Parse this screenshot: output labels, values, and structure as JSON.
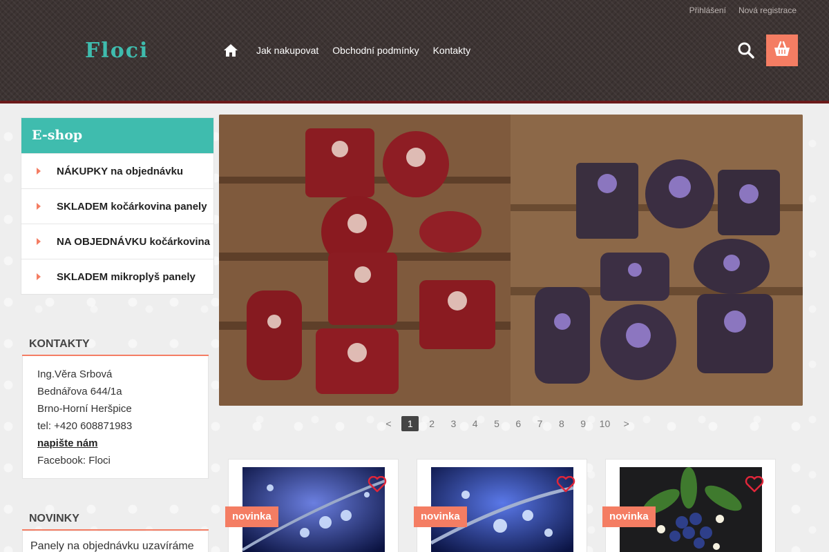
{
  "top_links": [
    "Přihlášení",
    "Nová registrace"
  ],
  "logo": "Floci",
  "nav": {
    "home_icon": "home-icon",
    "items": [
      "Jak nakupovat",
      "Obchodní podmínky",
      "Kontakty"
    ]
  },
  "icons": {
    "search": "search-icon",
    "cart": "cart-icon"
  },
  "eshop": {
    "title": "E-shop",
    "categories": [
      "NÁKUPKY na objednávku",
      "SKLADEM kočárkovina panely",
      "NA OBJEDNÁVKU kočárkovina",
      "SKLADEM mikroplyš panely"
    ]
  },
  "kontakty": {
    "title": "KONTAKTY",
    "name": "Ing.Věra Srbová",
    "street": "Bednářova 644/1a",
    "city": "Brno-Horní Heršpice",
    "tel": "tel: +420 608871983",
    "write_us": "napište nám",
    "facebook": "Facebook: Floci"
  },
  "novinky": {
    "title": "NOVINKY",
    "text": "Panely na objednávku uzavíráme"
  },
  "slider": {
    "pages": [
      "<",
      "1",
      "2",
      "3",
      "4",
      "5",
      "6",
      "7",
      "8",
      "9",
      "10",
      ">"
    ],
    "active_page": "1"
  },
  "products": [
    {
      "badge": "novinka"
    },
    {
      "badge": "novinka"
    },
    {
      "badge": "novinka"
    }
  ],
  "colors": {
    "accent_teal": "#3fbcae",
    "accent_coral": "#f47d63",
    "header_bg": "#3d3433"
  }
}
